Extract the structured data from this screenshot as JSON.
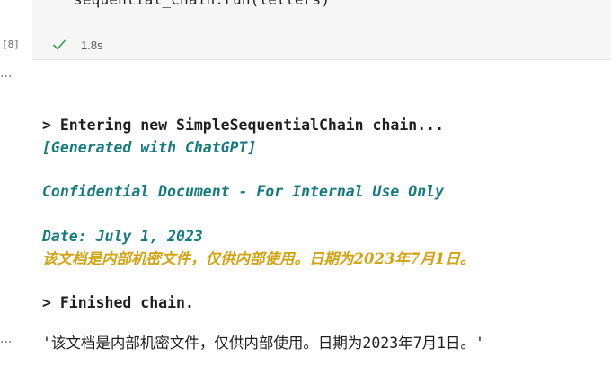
{
  "input_cell": {
    "code_visible": "sequential_chain.run(letters)",
    "execution_count": "[8]",
    "status_icon": "checkmark-icon",
    "duration": "1.8s",
    "colors": {
      "cell_background": "#f6f6f6",
      "check": "#3c9a4a"
    }
  },
  "output_cell": {
    "menu_glyph": "···",
    "lines": {
      "entering": "> Entering new SimpleSequentialChain chain...",
      "generated": "[Generated with ChatGPT]",
      "confidential": "Confidential Document - For Internal Use Only",
      "date": "Date: July 1, 2023",
      "translation": "该文档是内部机密文件，仅供内部使用。日期为2023年7月1日。",
      "finished": "> Finished chain.",
      "result": "'该文档是内部机密文件，仅供内部使用。日期为2023年7月1日。'"
    },
    "colors": {
      "teal": "#177c80",
      "gold": "#d2a313",
      "text": "#1f1f1f"
    }
  }
}
